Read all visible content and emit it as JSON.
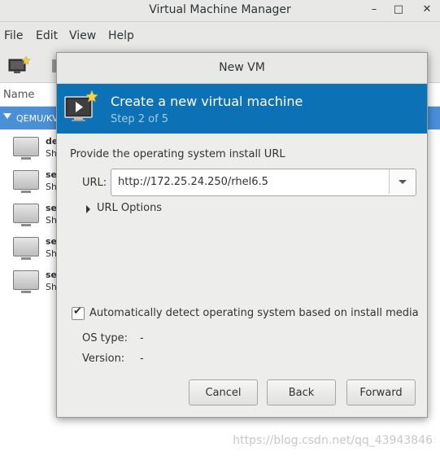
{
  "main_window": {
    "title": "Virtual Machine Manager",
    "menu": [
      "File",
      "Edit",
      "View",
      "Help"
    ],
    "list_header": "Name",
    "connection": "QEMU/KV",
    "vms": [
      {
        "name": "de",
        "status": "Sh"
      },
      {
        "name": "se",
        "status": "Sh"
      },
      {
        "name": "se",
        "status": "Sh"
      },
      {
        "name": "se",
        "status": "Sh"
      },
      {
        "name": "se",
        "status": "Sh"
      }
    ]
  },
  "dialog": {
    "title": "New VM",
    "banner_title": "Create a new virtual machine",
    "banner_step": "Step 2 of 5",
    "install_prompt": "Provide the operating system install URL",
    "url_label": "URL:",
    "url_value": "http://172.25.24.250/rhel6.5",
    "url_options_label": "URL Options",
    "detect_checked": true,
    "detect_label": "Automatically detect operating system based on install media",
    "os_type_label": "OS type:",
    "os_type_value": "-",
    "version_label": "Version:",
    "version_value": "-",
    "buttons": {
      "cancel": "Cancel",
      "back": "Back",
      "forward": "Forward"
    }
  },
  "watermark": "https://blog.csdn.net/qq_43943846",
  "colors": {
    "banner": "#0d72b5",
    "selection": "#4a90d9"
  }
}
